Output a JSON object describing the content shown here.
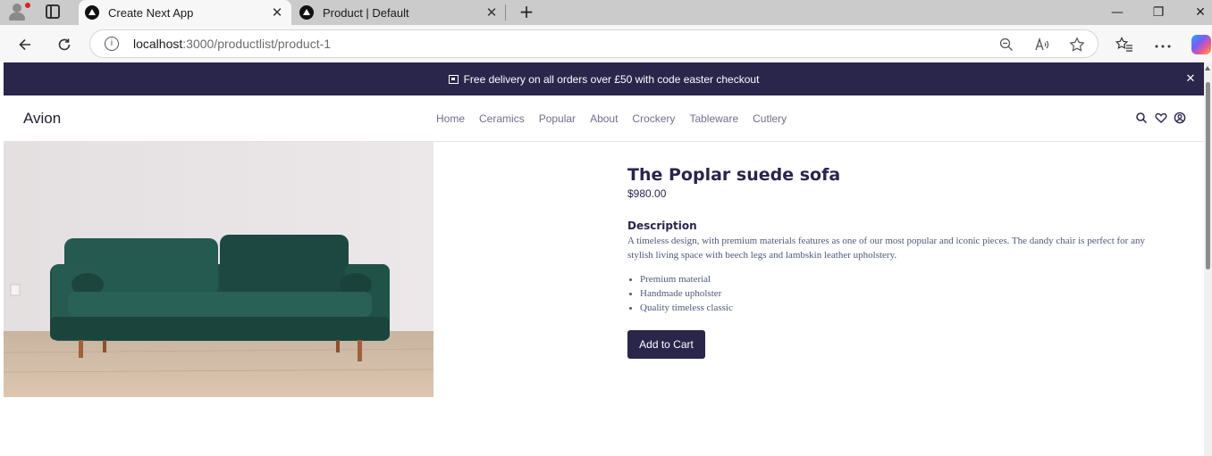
{
  "browser": {
    "tabs": [
      {
        "title": "Create Next App",
        "active": true
      },
      {
        "title": "Product | Default",
        "active": false
      }
    ],
    "url_host": "localhost",
    "url_path": ":3000/productlist/product-1",
    "close_glyph": "✕",
    "new_tab_glyph": "+",
    "window_controls": {
      "minimize": "—",
      "restore": "❐",
      "close": "✕"
    }
  },
  "promo": {
    "text": "Free delivery on all orders over £50 with code easter checkout",
    "close_glyph": "✕"
  },
  "header": {
    "logo": "Avion",
    "nav": [
      "Home",
      "Ceramics",
      "Popular",
      "About",
      "Crockery",
      "Tableware",
      "Cutlery"
    ],
    "icons": [
      "search-icon",
      "heart-icon",
      "user-icon"
    ]
  },
  "product": {
    "title": "The Poplar suede sofa",
    "price": "$980.00",
    "description_heading": "Description",
    "description": "A timeless design, with premium materials features as one of our most popular and iconic pieces. The dandy chair is perfect for any stylish living space with beech legs and lambskin leather upholstery.",
    "features": [
      "Premium material",
      "Handmade upholster",
      "Quality timeless classic"
    ],
    "add_to_cart": "Add to Cart"
  },
  "colors": {
    "brand_dark": "#2a254b",
    "nav_text": "#726e8d",
    "sofa_green": "#1f4d44"
  }
}
